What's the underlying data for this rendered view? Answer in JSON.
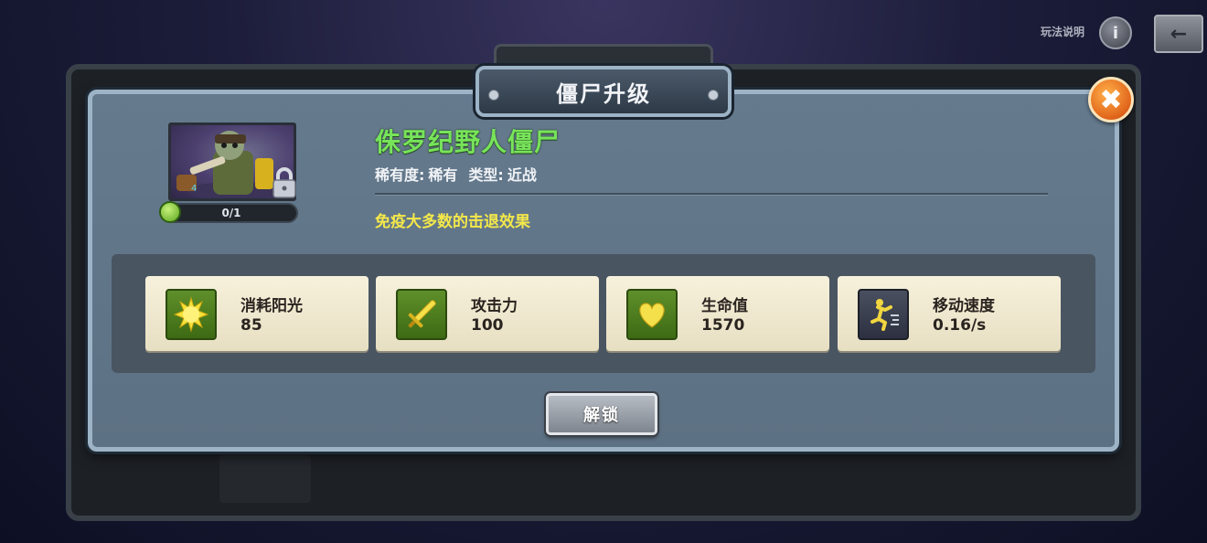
{
  "top_bar": {
    "help_label": "玩法说明",
    "help_icon": "info-icon",
    "back_icon": "back-arrow-icon"
  },
  "dialog": {
    "title": "僵尸升级",
    "close_icon": "close-x-icon"
  },
  "zombie": {
    "name": "侏罗纪野人僵尸",
    "rarity_label": "稀有度:",
    "rarity_value": "稀有",
    "type_label": "类型:",
    "type_value": "近战",
    "ability": "免疫大多数的击退效果",
    "progress": "0/1",
    "progress_fraction": 0,
    "locked": true
  },
  "stats": [
    {
      "label": "消耗阳光",
      "value": "85",
      "icon": "sun-icon"
    },
    {
      "label": "攻击力",
      "value": "100",
      "icon": "sword-icon"
    },
    {
      "label": "生命值",
      "value": "1570",
      "icon": "heart-icon"
    },
    {
      "label": "移动速度",
      "value": "0.16/s",
      "icon": "running-icon"
    }
  ],
  "unlock_button": "解锁",
  "colors": {
    "name_green": "#77e35a",
    "ability_yellow": "#f4e84a",
    "close_orange": "#e0641a",
    "panel_blue": "#657a8d"
  }
}
